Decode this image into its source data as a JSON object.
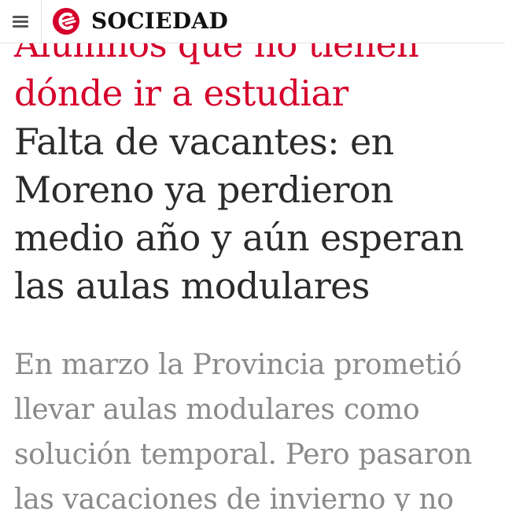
{
  "header": {
    "menu_icon": "hamburger-menu-icon",
    "logo_icon": "clarin-logo-icon",
    "section": "SOCIEDAD",
    "brand_color": "#d5002b"
  },
  "article": {
    "kicker_line1": "Alumnos que no tienen",
    "kicker_line2": "dónde ir a estudiar",
    "headline": "Falta de vacantes: en Moreno ya perdieron medio año y aún esperan las aulas modulares",
    "lead": "En marzo la Provincia prometió llevar aulas modulares como solución temporal. Pero pasaron las vacaciones de invierno y no",
    "colors": {
      "kicker": "#d5002b",
      "headline": "#2b2b2b",
      "lead": "#8a8a8a"
    }
  }
}
